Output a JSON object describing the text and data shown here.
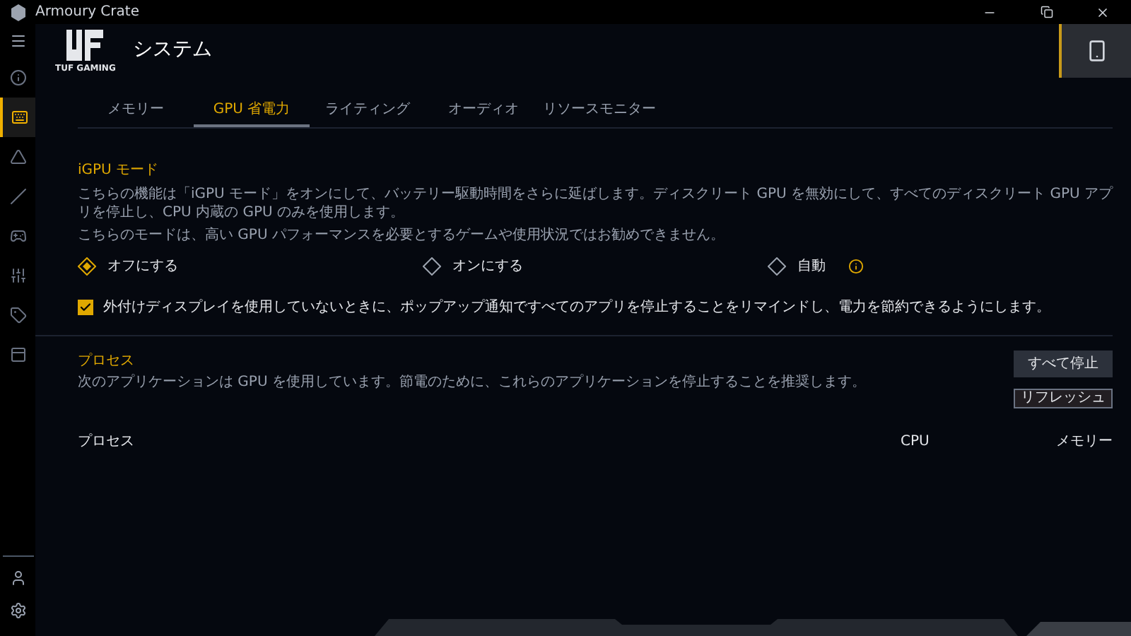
{
  "window": {
    "title": "Armoury Crate"
  },
  "sidebar": {
    "items": [
      {
        "kind": "info",
        "selected": false
      },
      {
        "kind": "keyboard",
        "selected": true
      },
      {
        "kind": "triangle",
        "selected": false
      },
      {
        "kind": "slash",
        "selected": false
      },
      {
        "kind": "gamepad",
        "selected": false
      },
      {
        "kind": "sliders",
        "selected": false
      },
      {
        "kind": "tag",
        "selected": false
      },
      {
        "kind": "panel",
        "selected": false
      }
    ]
  },
  "header": {
    "logo_text": "TUF GAMING",
    "title": "システム"
  },
  "tabs": [
    {
      "label": "メモリー",
      "selected": false
    },
    {
      "label": "GPU 省電力",
      "selected": true
    },
    {
      "label": "ライティング",
      "selected": false
    },
    {
      "label": "オーディオ",
      "selected": false
    },
    {
      "label": "リソースモニター",
      "selected": false
    }
  ],
  "igpu": {
    "title": "iGPU モード",
    "description": [
      "こちらの機能は「iGPU モード」をオンにして、バッテリー駆動時間をさらに延ばします。ディスクリート GPU を無効にして、すべてのディスクリート GPU アプリを停止し、CPU 内蔵の GPU のみを使用します。",
      "こちらのモードは、高い GPU パフォーマンスを必要とするゲームや使用状況ではお勧めできません。"
    ],
    "options": [
      {
        "label": "オフにする",
        "selected": true
      },
      {
        "label": "オンにする",
        "selected": false
      },
      {
        "label": "自動",
        "selected": false
      }
    ],
    "reminder": {
      "label": "外付けディスプレイを使用していないときに、ポップアップ通知ですべてのアプリを停止することをリマインドし、電力を節約できるようにします。",
      "checked": true
    }
  },
  "process": {
    "title": "プロセス",
    "description": "次のアプリケーションは GPU を使用しています。節電のために、これらのアプリケーションを停止することを推奨します。",
    "stop_all": "すべて停止",
    "refresh": "リフレッシュ",
    "columns": [
      "プロセス",
      "CPU",
      "メモリー"
    ]
  }
}
